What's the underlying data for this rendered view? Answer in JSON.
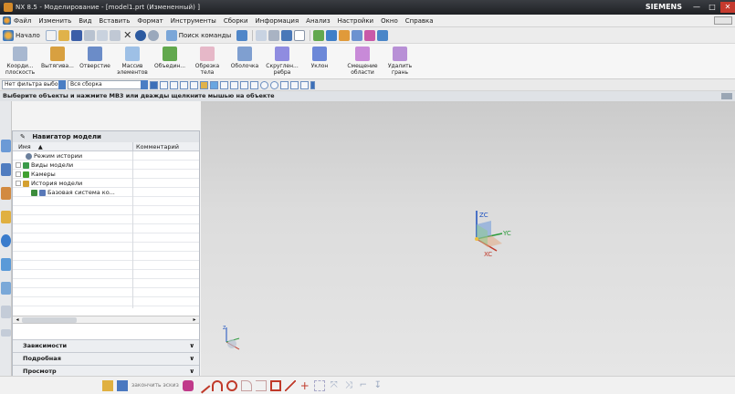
{
  "window": {
    "title": "NX 8.5 - Моделирование - [model1.prt (Измененный) ]",
    "brand": "SIEMENS",
    "controls": {
      "minimize": "—",
      "maximize": "□",
      "close": "✕"
    }
  },
  "menu": [
    "Файл",
    "Изменить",
    "Вид",
    "Вставить",
    "Формат",
    "Инструменты",
    "Сборки",
    "Информация",
    "Анализ",
    "Настройки",
    "Окно",
    "Справка"
  ],
  "toolbar": {
    "start_label": "Начало",
    "search_label": "Поиск команды"
  },
  "ribbon": [
    {
      "label": "Коорди... плоскость",
      "color": "#a8b8d0"
    },
    {
      "label": "Вытягива...",
      "color": "#d8a040"
    },
    {
      "label": "Отверстие",
      "color": "#6b8cc8"
    },
    {
      "label": "Массив элементов",
      "color": "#9ec0e6"
    },
    {
      "label": "Объедин...",
      "color": "#62a84e"
    },
    {
      "label": "Обрезка тела",
      "color": "#e6b8c8"
    },
    {
      "label": "Оболочка",
      "color": "#7f9fd0"
    },
    {
      "label": "Скруглен... ребра",
      "color": "#8f8ce0"
    },
    {
      "label": "Уклон",
      "color": "#6c88d8"
    },
    {
      "label": "Смещение области",
      "color": "#c88ad8"
    },
    {
      "label": "Удалить грань",
      "color": "#b890d6"
    }
  ],
  "selection": {
    "filter": "Нет фильтра выбо",
    "scope": "Вся сборка"
  },
  "cue_line": "Выберите объекты и нажмите MB3 или дважды щелкните мышью на объекте",
  "navigator": {
    "title": "Навигатор модели",
    "columns": [
      "Имя",
      "Комментарий"
    ],
    "rows": [
      {
        "label": "Режим истории",
        "indent": 8,
        "icon": "#6a7f9c",
        "expander": false
      },
      {
        "label": "Виды модели",
        "indent": 2,
        "icon": "#3a9a4a",
        "expander": true
      },
      {
        "label": "Камеры",
        "indent": 2,
        "icon": "#40a030",
        "expander": true
      },
      {
        "label": "История модели",
        "indent": 2,
        "icon": "#d4a030",
        "expander": true
      },
      {
        "label": "Базовая система ко...",
        "indent": 14,
        "icon": "#3c8c3c",
        "expander": false
      }
    ],
    "panels": [
      "Зависимости",
      "Подробная",
      "Просмотр"
    ]
  },
  "viewport": {
    "triad": {
      "x": "XC",
      "y": "YC",
      "z": "ZC"
    },
    "wcs_labels": {
      "x": "X",
      "y": "Y",
      "z": "Z"
    }
  },
  "bottom": {
    "hint": "закончить эскиз"
  }
}
